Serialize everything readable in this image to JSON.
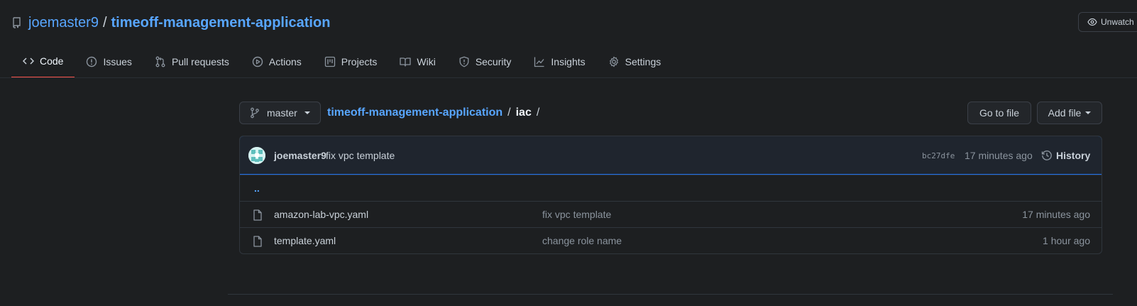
{
  "repo": {
    "owner": "joemaster9",
    "separator": "/",
    "name": "timeoff-management-application"
  },
  "watch": {
    "label": "Unwatch"
  },
  "tabs": [
    {
      "label": "Code",
      "icon": "code-icon",
      "active": true
    },
    {
      "label": "Issues",
      "icon": "issue-icon"
    },
    {
      "label": "Pull requests",
      "icon": "pull-request-icon"
    },
    {
      "label": "Actions",
      "icon": "play-icon"
    },
    {
      "label": "Projects",
      "icon": "project-icon"
    },
    {
      "label": "Wiki",
      "icon": "book-icon"
    },
    {
      "label": "Security",
      "icon": "shield-icon"
    },
    {
      "label": "Insights",
      "icon": "graph-icon"
    },
    {
      "label": "Settings",
      "icon": "gear-icon"
    }
  ],
  "branch": {
    "name": "master"
  },
  "breadcrumb": {
    "root": "timeoff-management-application",
    "sep1": "/",
    "dir": "iac",
    "sep2": "/"
  },
  "buttons": {
    "goto_file": "Go to file",
    "add_file": "Add file"
  },
  "commit": {
    "author": "joemaster9",
    "message": "fix vpc template",
    "sha": "bc27dfe",
    "time": "17 minutes ago",
    "history_label": "History"
  },
  "files": {
    "parent": "..",
    "items": [
      {
        "name": "amazon-lab-vpc.yaml",
        "message": "fix vpc template",
        "time": "17 minutes ago"
      },
      {
        "name": "template.yaml",
        "message": "change role name",
        "time": "1 hour ago"
      }
    ]
  },
  "colors": {
    "accent": "#58a6ff",
    "active_tab": "#f85149",
    "commit_border": "#1f6feb",
    "background": "#1d1f21"
  }
}
